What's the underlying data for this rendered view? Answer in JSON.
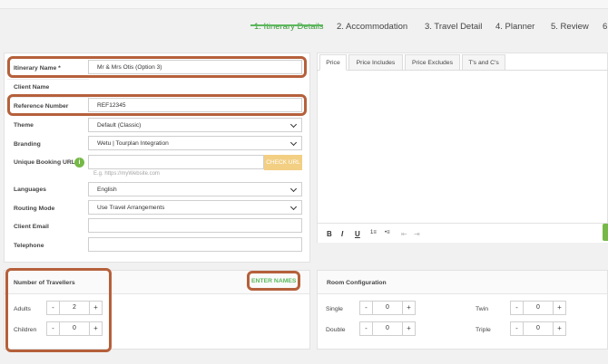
{
  "wizard": {
    "steps": [
      {
        "label": "1. Itinerary Details",
        "active": true
      },
      {
        "label": "2. Accommodation"
      },
      {
        "label": "3. Travel Detail"
      },
      {
        "label": "4. Planner"
      },
      {
        "label": "5. Review"
      },
      {
        "label": "6"
      }
    ]
  },
  "form": {
    "itinerary_name": {
      "label": "Itinerary Name *",
      "value": "Mr & Mrs Otis (Option 3)"
    },
    "client_name": {
      "label": "Client Name",
      "value": ""
    },
    "reference_number": {
      "label": "Reference Number",
      "value": "REF12345"
    },
    "theme": {
      "label": "Theme",
      "value": "Default (Classic)"
    },
    "branding": {
      "label": "Branding",
      "value": "Wetu | Tourplan Integration"
    },
    "booking_url": {
      "label": "Unique Booking URL",
      "value": "",
      "placeholder": "E.g. https://myWebsite.com",
      "button": "CHECK URL",
      "info_glyph": "i"
    },
    "languages": {
      "label": "Languages",
      "value": "English"
    },
    "routing_mode": {
      "label": "Routing Mode",
      "value": "Use Travel Arrangements"
    },
    "client_email": {
      "label": "Client Email",
      "value": ""
    },
    "telephone": {
      "label": "Telephone",
      "value": ""
    }
  },
  "price_tabs": [
    "Price",
    "Price Includes",
    "Price Excludes",
    "T's and C's"
  ],
  "editor_toolbar": {
    "bold": "B",
    "italic": "I",
    "underline": "U",
    "ol": "1≡",
    "ul": "•≡",
    "outdent": "⇤",
    "indent": "⇥"
  },
  "travellers": {
    "title": "Number of Travellers",
    "enter_names": "ENTER NAMES",
    "adults": {
      "label": "Adults",
      "value": "2"
    },
    "children": {
      "label": "Children",
      "value": "0"
    }
  },
  "rooms": {
    "title": "Room Configuration",
    "single": {
      "label": "Single",
      "value": "0"
    },
    "double": {
      "label": "Double",
      "value": "0"
    },
    "twin": {
      "label": "Twin",
      "value": "0"
    },
    "triple": {
      "label": "Triple",
      "value": "0"
    }
  },
  "stepper_symbols": {
    "minus": "-",
    "plus": "+"
  },
  "colors": {
    "accent_green": "#5cb85c",
    "highlight": "#b5603b",
    "check_url": "#f3cf83"
  }
}
